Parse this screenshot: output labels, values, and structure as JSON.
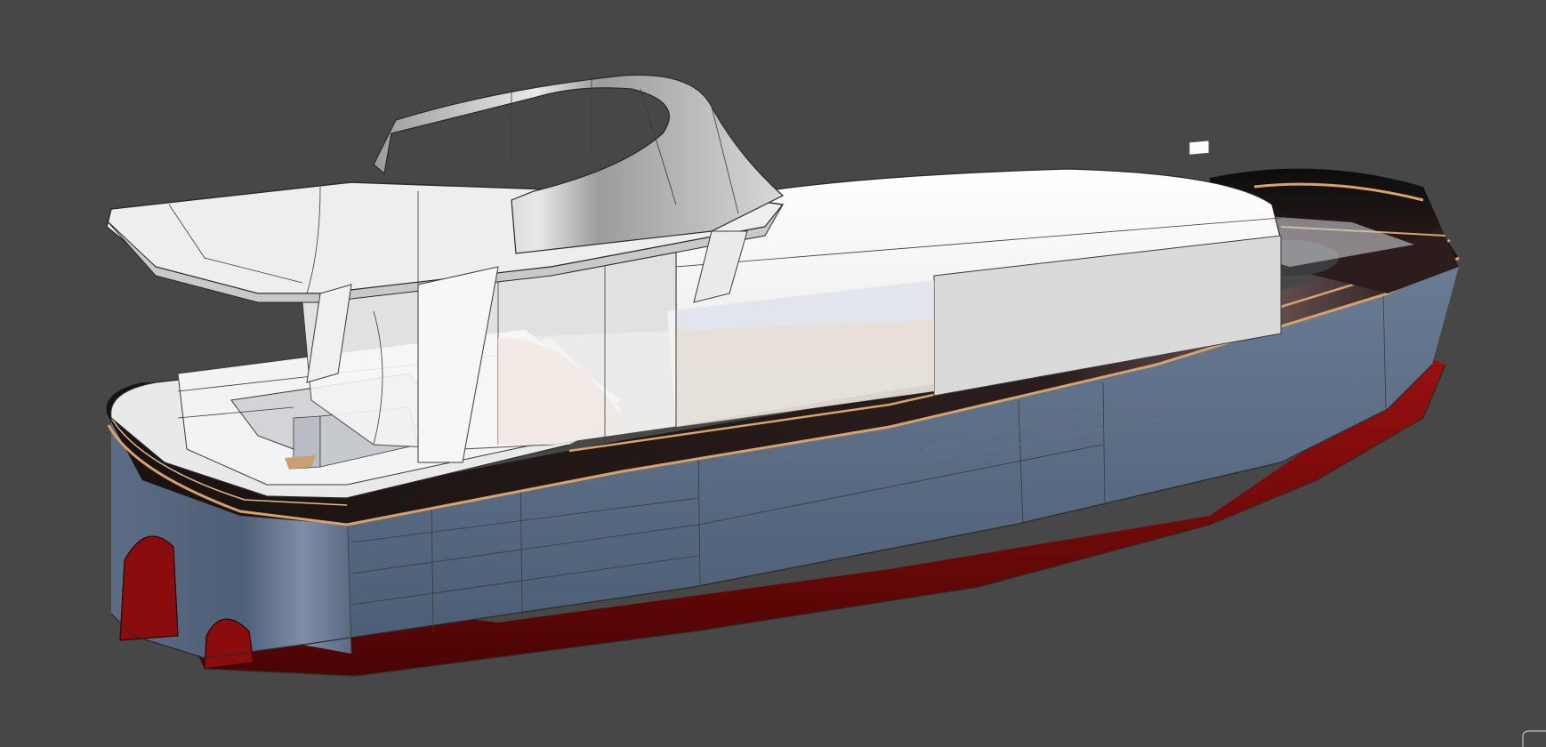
{
  "viewport": {
    "background": "#474747"
  },
  "model": {
    "colors": {
      "hull_lower": "#7a0a0a",
      "hull_lower_dark": "#4a0404",
      "hull_side": "#4b5d74",
      "hull_side_light": "#6d7f96",
      "rub_rail": "#1b1414",
      "trim_line": "#d8a26a",
      "superstructure": "#f3f3f3",
      "superstructure_shade": "#d5d5d5",
      "glass_tint": "#c9ccd2",
      "deck_wood": "#eadccb"
    }
  },
  "corner_widget": {
    "icon": "view-cube-icon"
  }
}
